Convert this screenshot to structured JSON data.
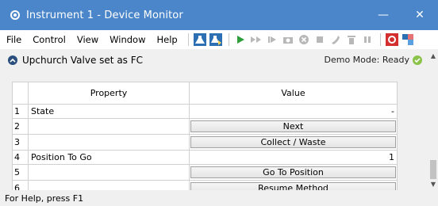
{
  "window": {
    "title": "Instrument 1 - Device Monitor",
    "minimize_glyph": "—",
    "close_glyph": "✕"
  },
  "menu": {
    "items": [
      "File",
      "Control",
      "View",
      "Window",
      "Help"
    ]
  },
  "toolbar": {
    "icons": [
      "flask-icon",
      "flask-run-icon",
      "play-icon",
      "skip-icon",
      "step-icon",
      "camera-icon",
      "stop-circle-icon",
      "stop-icon",
      "pump-icon",
      "valve-icon",
      "pause-icon",
      "record-icon",
      "network-icon"
    ],
    "colors": {
      "play": "#2e9e3b",
      "disabled": "#b8b8b8",
      "record": "#d32f2f",
      "accent": "#2d6fb3"
    }
  },
  "panel": {
    "title": "Upchurch Valve set as FC",
    "status": "Demo Mode: Ready",
    "status_color": "#8bc34a"
  },
  "grid": {
    "columns": [
      "Property",
      "Value"
    ],
    "rows": [
      {
        "num": "1",
        "property": "State",
        "value": "-",
        "button": ""
      },
      {
        "num": "2",
        "property": "",
        "value": "",
        "button": "Next"
      },
      {
        "num": "3",
        "property": "",
        "value": "",
        "button": "Collect / Waste"
      },
      {
        "num": "4",
        "property": "Position To Go",
        "value": "1",
        "button": ""
      },
      {
        "num": "5",
        "property": "",
        "value": "",
        "button": "Go To Position"
      },
      {
        "num": "6",
        "property": "",
        "value": "",
        "button": "Resume Method"
      }
    ]
  },
  "statusbar": {
    "text": "For Help, press F1"
  }
}
